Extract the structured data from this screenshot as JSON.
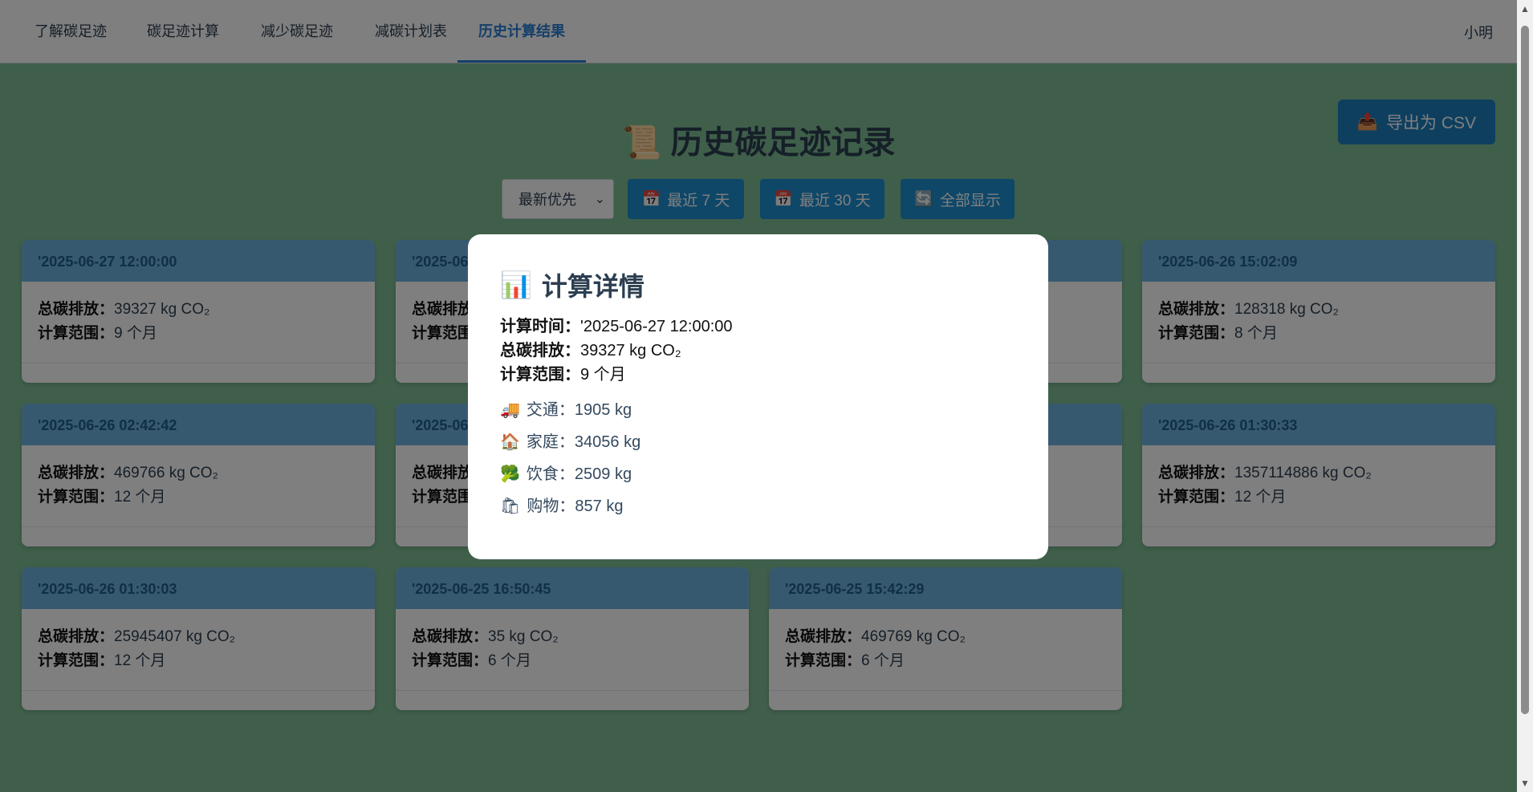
{
  "nav": {
    "items": [
      {
        "label": "了解碳足迹"
      },
      {
        "label": "碳足迹计算"
      },
      {
        "label": "减少碳足迹"
      },
      {
        "label": "减碳计划表"
      },
      {
        "label": "历史计算结果"
      }
    ],
    "active_index": 4,
    "user": "小明"
  },
  "page": {
    "title": "历史碳足迹记录",
    "title_icon": "📜",
    "export_label": "导出为 CSV",
    "export_icon": "📤"
  },
  "filters": {
    "sort_value": "最新优先",
    "btn_7": "最近 7 天",
    "btn_30": "最近 30 天",
    "btn_all": "全部显示",
    "calendar_icon": "📅",
    "refresh_icon": "🔄"
  },
  "labels": {
    "total": "总碳排放：",
    "range": "计算范围：",
    "time": "计算时间："
  },
  "cards": [
    {
      "time": "'2025-06-27 12:00:00",
      "total": "39327 kg CO₂",
      "range": "9 个月"
    },
    {
      "time": "'2025-06-26 15:02:09",
      "total": "128318 kg CO₂",
      "range": "8 个月"
    },
    {
      "time": "'2025-06-26 02:42:42",
      "total": "469766 kg CO₂",
      "range": "12 个月"
    },
    {
      "time": "'2025-06-26 01:30:33",
      "total": "1357114886 kg CO₂",
      "range": "12 个月"
    },
    {
      "time": "'2025-06-26 01:30:03",
      "total": "25945407 kg CO₂",
      "range": "12 个月"
    },
    {
      "time": "'2025-06-25 16:50:45",
      "total": "35 kg CO₂",
      "range": "6 个月"
    },
    {
      "time": "'2025-06-25 15:42:29",
      "total": "469769 kg CO₂",
      "range": "6 个月"
    },
    {
      "time": "'2025-06",
      "total": "",
      "range": ""
    },
    {
      "time": "'2025-06",
      "total": "",
      "range": ""
    }
  ],
  "modal": {
    "title": "计算详情",
    "title_icon": "📊",
    "time_value": "'2025-06-27 12:00:00",
    "total_value": "39327 kg CO₂",
    "range_value": "9 个月",
    "details": [
      {
        "icon": "🚚",
        "text": "交通：1905 kg"
      },
      {
        "icon": "🏠",
        "text": "家庭：34056 kg"
      },
      {
        "icon": "🥦",
        "text": "饮食：2509 kg"
      },
      {
        "icon": "🛍",
        "text": "购物：857 kg"
      }
    ]
  }
}
